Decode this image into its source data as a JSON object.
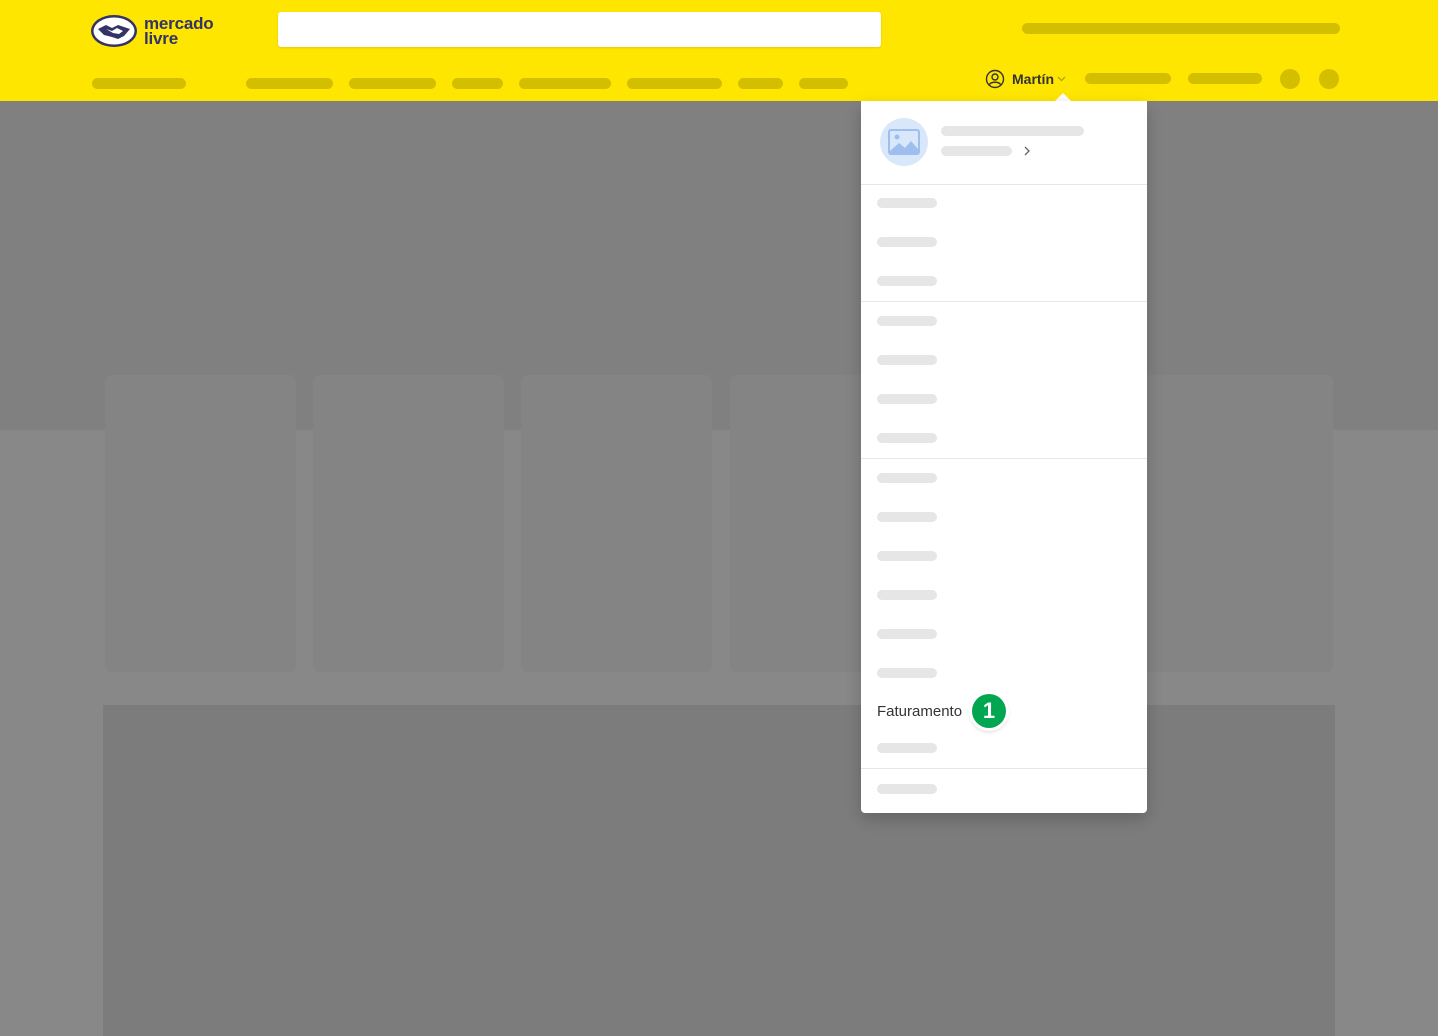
{
  "header": {
    "brand_line1": "mercado",
    "brand_line2": "livre",
    "search_placeholder": "",
    "user_name": "Martín"
  },
  "dropdown": {
    "billing_label": "Faturamento",
    "step_badge": "1"
  },
  "colors": {
    "header_bg": "#ffe600",
    "badge": "#00a650",
    "brand_text": "#333366"
  },
  "icons": [
    "handshake-logo-icon",
    "user-icon",
    "chevron-down-icon",
    "image-placeholder-icon",
    "chevron-right-icon"
  ]
}
